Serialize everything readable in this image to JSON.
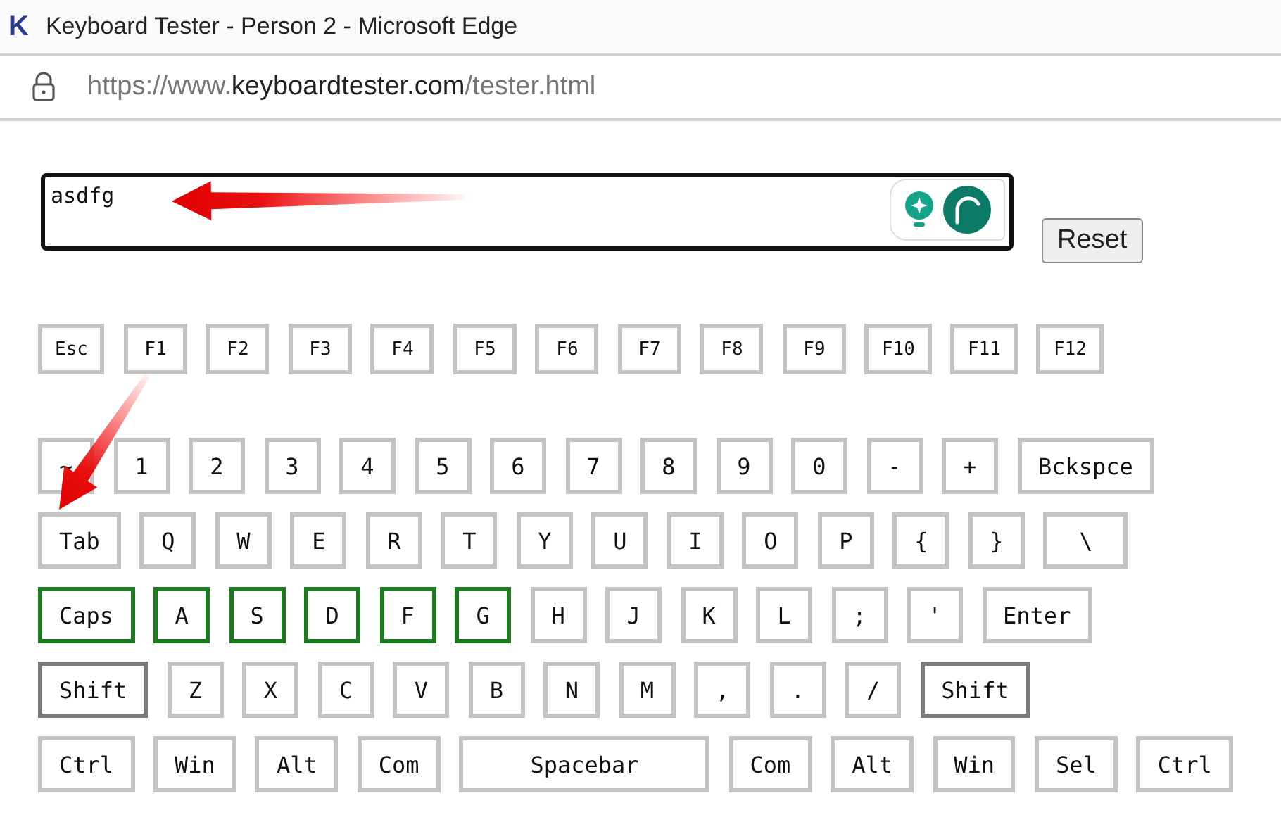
{
  "window": {
    "title": "Keyboard Tester - Person 2 - Microsoft Edge",
    "favicon": "K"
  },
  "address_bar": {
    "url_prefix": "https://www.",
    "url_domain": "keyboardtester.com",
    "url_path": "/tester.html"
  },
  "text_area": {
    "value": "asdfg"
  },
  "reset_button": "Reset",
  "keyboard": {
    "key_rows": [
      {
        "keys": [
          {
            "label": "Esc",
            "kind": "key",
            "pressed": false,
            "held": false
          },
          {
            "label": "F1",
            "kind": "key",
            "pressed": false,
            "held": false
          },
          {
            "label": "F2",
            "kind": "key",
            "pressed": false,
            "held": false
          },
          {
            "label": "F3",
            "kind": "key",
            "pressed": false,
            "held": false
          },
          {
            "label": "F4",
            "kind": "key",
            "pressed": false,
            "held": false
          },
          {
            "label": "F5",
            "kind": "key",
            "pressed": false,
            "held": false
          },
          {
            "label": "F6",
            "kind": "key",
            "pressed": false,
            "held": false
          },
          {
            "label": "F7",
            "kind": "key",
            "pressed": false,
            "held": false
          },
          {
            "label": "F8",
            "kind": "key",
            "pressed": false,
            "held": false
          },
          {
            "label": "F9",
            "kind": "key",
            "pressed": false,
            "held": false
          },
          {
            "label": "F10",
            "kind": "key",
            "pressed": false,
            "held": false
          },
          {
            "label": "F11",
            "kind": "key",
            "pressed": false,
            "held": false
          },
          {
            "label": "F12",
            "kind": "key",
            "pressed": false,
            "held": false
          }
        ]
      },
      {
        "keys": [
          {
            "label": "~",
            "kind": "key",
            "pressed": false,
            "held": false
          },
          {
            "label": "1",
            "kind": "key",
            "pressed": false,
            "held": false
          },
          {
            "label": "2",
            "kind": "key",
            "pressed": false,
            "held": false
          },
          {
            "label": "3",
            "kind": "key",
            "pressed": false,
            "held": false
          },
          {
            "label": "4",
            "kind": "key",
            "pressed": false,
            "held": false
          },
          {
            "label": "5",
            "kind": "key",
            "pressed": false,
            "held": false
          },
          {
            "label": "6",
            "kind": "key",
            "pressed": false,
            "held": false
          },
          {
            "label": "7",
            "kind": "key",
            "pressed": false,
            "held": false
          },
          {
            "label": "8",
            "kind": "key",
            "pressed": false,
            "held": false
          },
          {
            "label": "9",
            "kind": "key",
            "pressed": false,
            "held": false
          },
          {
            "label": "0",
            "kind": "key",
            "pressed": false,
            "held": false
          },
          {
            "label": "-",
            "kind": "key",
            "pressed": false,
            "held": false
          },
          {
            "label": "+",
            "kind": "key",
            "pressed": false,
            "held": false
          },
          {
            "label": "Bckspce",
            "kind": "key",
            "pressed": false,
            "held": false
          }
        ]
      },
      {
        "keys": [
          {
            "label": "Tab",
            "kind": "key",
            "pressed": false,
            "held": false
          },
          {
            "label": "Q",
            "kind": "key",
            "pressed": false,
            "held": false
          },
          {
            "label": "W",
            "kind": "key",
            "pressed": false,
            "held": false
          },
          {
            "label": "E",
            "kind": "key",
            "pressed": false,
            "held": false
          },
          {
            "label": "R",
            "kind": "key",
            "pressed": false,
            "held": false
          },
          {
            "label": "T",
            "kind": "key",
            "pressed": false,
            "held": false
          },
          {
            "label": "Y",
            "kind": "key",
            "pressed": false,
            "held": false
          },
          {
            "label": "U",
            "kind": "key",
            "pressed": false,
            "held": false
          },
          {
            "label": "I",
            "kind": "key",
            "pressed": false,
            "held": false
          },
          {
            "label": "O",
            "kind": "key",
            "pressed": false,
            "held": false
          },
          {
            "label": "P",
            "kind": "key",
            "pressed": false,
            "held": false
          },
          {
            "label": "{",
            "kind": "key",
            "pressed": false,
            "held": false
          },
          {
            "label": "}",
            "kind": "key",
            "pressed": false,
            "held": false
          },
          {
            "label": "\\",
            "kind": "wide",
            "pressed": false,
            "held": false
          }
        ]
      },
      {
        "keys": [
          {
            "label": "Caps",
            "kind": "key",
            "pressed": true,
            "held": false
          },
          {
            "label": "A",
            "kind": "key",
            "pressed": true,
            "held": false
          },
          {
            "label": "S",
            "kind": "key",
            "pressed": true,
            "held": false
          },
          {
            "label": "D",
            "kind": "key",
            "pressed": true,
            "held": false
          },
          {
            "label": "F",
            "kind": "key",
            "pressed": true,
            "held": false
          },
          {
            "label": "G",
            "kind": "key",
            "pressed": true,
            "held": false
          },
          {
            "label": "H",
            "kind": "key",
            "pressed": false,
            "held": false
          },
          {
            "label": "J",
            "kind": "key",
            "pressed": false,
            "held": false
          },
          {
            "label": "K",
            "kind": "key",
            "pressed": false,
            "held": false
          },
          {
            "label": "L",
            "kind": "key",
            "pressed": false,
            "held": false
          },
          {
            "label": ";",
            "kind": "key",
            "pressed": false,
            "held": false
          },
          {
            "label": "'",
            "kind": "key",
            "pressed": false,
            "held": false
          },
          {
            "label": "Enter",
            "kind": "key",
            "pressed": false,
            "held": false
          }
        ]
      },
      {
        "keys": [
          {
            "label": "Shift",
            "kind": "key",
            "pressed": false,
            "held": true
          },
          {
            "label": "Z",
            "kind": "key",
            "pressed": false,
            "held": false
          },
          {
            "label": "X",
            "kind": "key",
            "pressed": false,
            "held": false
          },
          {
            "label": "C",
            "kind": "key",
            "pressed": false,
            "held": false
          },
          {
            "label": "V",
            "kind": "key",
            "pressed": false,
            "held": false
          },
          {
            "label": "B",
            "kind": "key",
            "pressed": false,
            "held": false
          },
          {
            "label": "N",
            "kind": "key",
            "pressed": false,
            "held": false
          },
          {
            "label": "M",
            "kind": "key",
            "pressed": false,
            "held": false
          },
          {
            "label": ",",
            "kind": "key",
            "pressed": false,
            "held": false
          },
          {
            "label": ".",
            "kind": "key",
            "pressed": false,
            "held": false
          },
          {
            "label": "/",
            "kind": "key",
            "pressed": false,
            "held": false
          },
          {
            "label": "Shift",
            "kind": "key",
            "pressed": false,
            "held": true
          }
        ]
      },
      {
        "keys": [
          {
            "label": "Ctrl",
            "kind": "key",
            "pressed": false,
            "held": false
          },
          {
            "label": "Win",
            "kind": "key",
            "pressed": false,
            "held": false
          },
          {
            "label": "Alt",
            "kind": "key",
            "pressed": false,
            "held": false
          },
          {
            "label": "Com",
            "kind": "key",
            "pressed": false,
            "held": false
          },
          {
            "label": "Spacebar",
            "kind": "spacebar",
            "pressed": false,
            "held": false
          },
          {
            "label": "Com",
            "kind": "key",
            "pressed": false,
            "held": false
          },
          {
            "label": "Alt",
            "kind": "key",
            "pressed": false,
            "held": false
          },
          {
            "label": "Win",
            "kind": "key",
            "pressed": false,
            "held": false
          },
          {
            "label": "Sel",
            "kind": "key",
            "pressed": false,
            "held": false
          },
          {
            "label": "Ctrl",
            "kind": "key",
            "pressed": false,
            "held": false
          }
        ]
      }
    ]
  }
}
